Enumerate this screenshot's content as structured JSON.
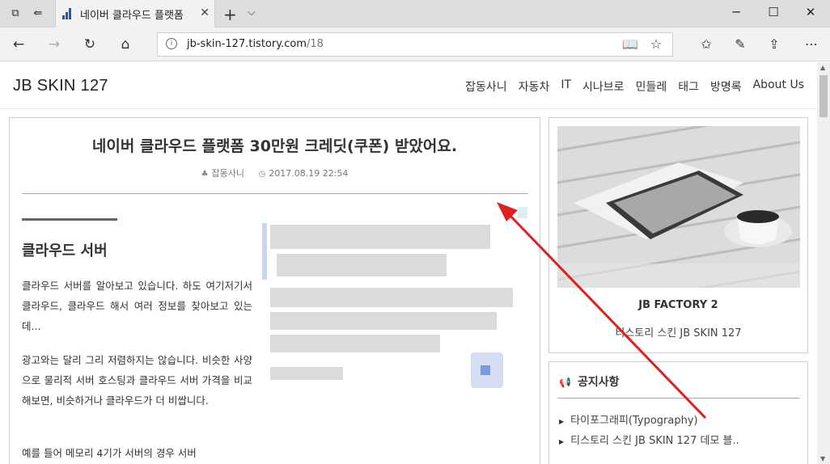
{
  "browser": {
    "tab_title": "네이버 클라우드 플랫폼",
    "url_host": "jb-skin-127.tistory.com",
    "url_path": "/18"
  },
  "site": {
    "logo": "JB SKIN 127",
    "menu": [
      "잡동사니",
      "자동차",
      "IT",
      "시나브로",
      "민들레",
      "태그",
      "방명록",
      "About Us"
    ]
  },
  "article": {
    "title": "네이버 클라우드 플랫폼 30만원 크레딧(쿠폰) 받았어요.",
    "category": "잡동사니",
    "datetime": "2017.08.19 22:54",
    "heading": "클라우드 서버",
    "para1": "클라우드 서버를 알아보고 있습니다. 하도 여기저기서 클라우드, 클라우드 해서 여러 정보를 찾아보고 있는데...",
    "para2": "광고와는 달리 그리 저렴하지는 않습니다. 비슷한 사양으로 물리적 서버 호스팅과 클라우드 서버 가격을 비교해보면, 비슷하거나 클라우드가 더 비쌉니다.",
    "para3": "예를 들어 메모리 4기가 서버의 경우 서버"
  },
  "sidebar": {
    "card_title": "JB FACTORY 2",
    "card_desc": "티스토리 스킨 JB SKIN 127",
    "notice_title": "공지사항",
    "notices": [
      "타이포그래피(Typography)",
      "티스토리 스킨 JB SKIN 127 데모 블.."
    ]
  },
  "colors": {
    "annotation_arrow": "#e02020",
    "favicon": "#1e5bb8"
  }
}
